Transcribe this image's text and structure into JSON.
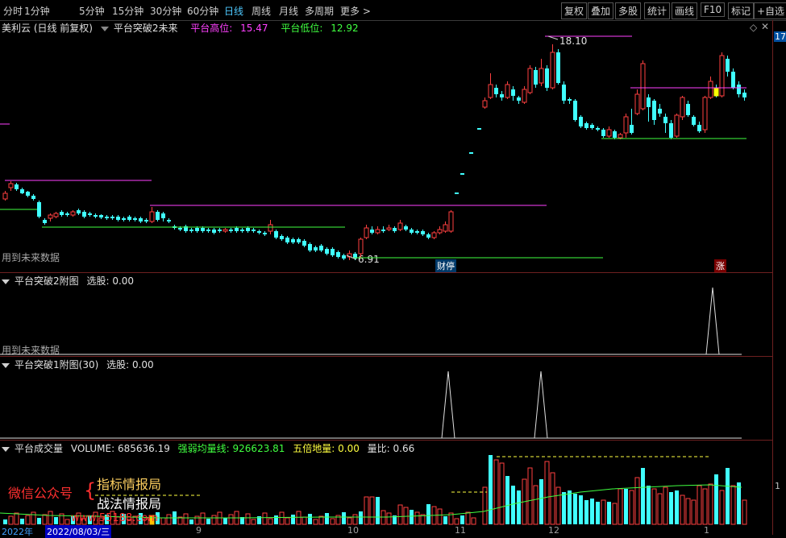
{
  "toolbar": {
    "periods": [
      "分时",
      "1分钟",
      "5分钟",
      "15分钟",
      "30分钟",
      "60分钟",
      "日线",
      "周线",
      "月线",
      "多周期",
      "更多 >"
    ],
    "active": "日线",
    "right": [
      "复权",
      "叠加",
      "多股",
      "统计",
      "画线",
      "F10",
      "标记",
      "+自选"
    ]
  },
  "main": {
    "stock": "美利云 (日线 前复权)",
    "indicator": "平台突破2未来",
    "high_label": "平台高位:",
    "high_value": "15.47",
    "low_label": "平台低位:",
    "low_value": "12.92",
    "max_price": "18.10",
    "min_price": "6.91",
    "future_note": "用到未来数据",
    "badge_cai": "财停",
    "badge_zhang": "涨",
    "axis_tag": "17"
  },
  "sub1": {
    "title": "平台突破2附图",
    "field": "选股: 0.00",
    "future_note": "用到未来数据"
  },
  "sub2": {
    "title": "平台突破1附图(30)",
    "field": "选股: 0.00"
  },
  "sub3": {
    "title": "平台成交量",
    "volume": "VOLUME: 685636.19",
    "strength": "强弱均量线: 926623.81",
    "five": "五倍地量: 0.00",
    "ratio": "量比: 0.66",
    "axis_tag": "1"
  },
  "watermark": {
    "wechat": "微信公众号",
    "line1": "指标情报局",
    "line2": "战法情报局",
    "site": "www.55188.com"
  },
  "dates": {
    "year": "2022年",
    "cursor": "2022/08/03/三",
    "months": [
      "9",
      "10",
      "11",
      "12",
      "1"
    ]
  },
  "colors": {
    "up": "#ff4040",
    "down": "#40ffff",
    "magenta": "#ff40ff",
    "green": "#40ff40",
    "active": "#4ec9ff"
  }
}
